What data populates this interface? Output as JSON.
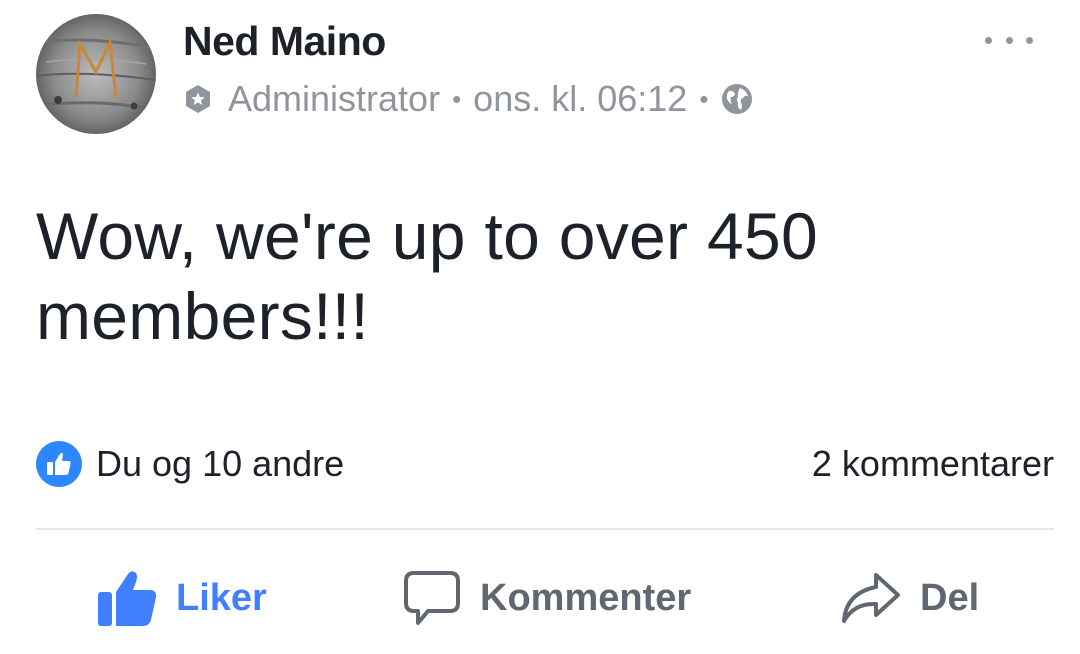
{
  "post": {
    "author": "Ned Maino",
    "role": "Administrator",
    "separator": "•",
    "timestamp": "ons. kl. 06:12",
    "text": "Wow, we're up to over 450 members!!!",
    "likes_summary": "Du og 10 andre",
    "comments_count": "2 kommentarer"
  },
  "actions": {
    "like_label": "Liker",
    "comment_label": "Kommenter",
    "share_label": "Del"
  },
  "icons": {
    "admin_badge": "admin-badge-icon",
    "privacy": "globe-icon",
    "more": "more-options-icon",
    "reaction": "thumbs-up-reaction-icon",
    "like": "thumbs-up-icon",
    "comment": "speech-bubble-icon",
    "share": "share-arrow-icon"
  },
  "colors": {
    "accent": "#4080ff",
    "reaction_bubble": "#2d88ff",
    "text": "#1d2129",
    "secondary": "#90949c",
    "action_gray": "#606770",
    "divider": "#e6e7e9"
  }
}
